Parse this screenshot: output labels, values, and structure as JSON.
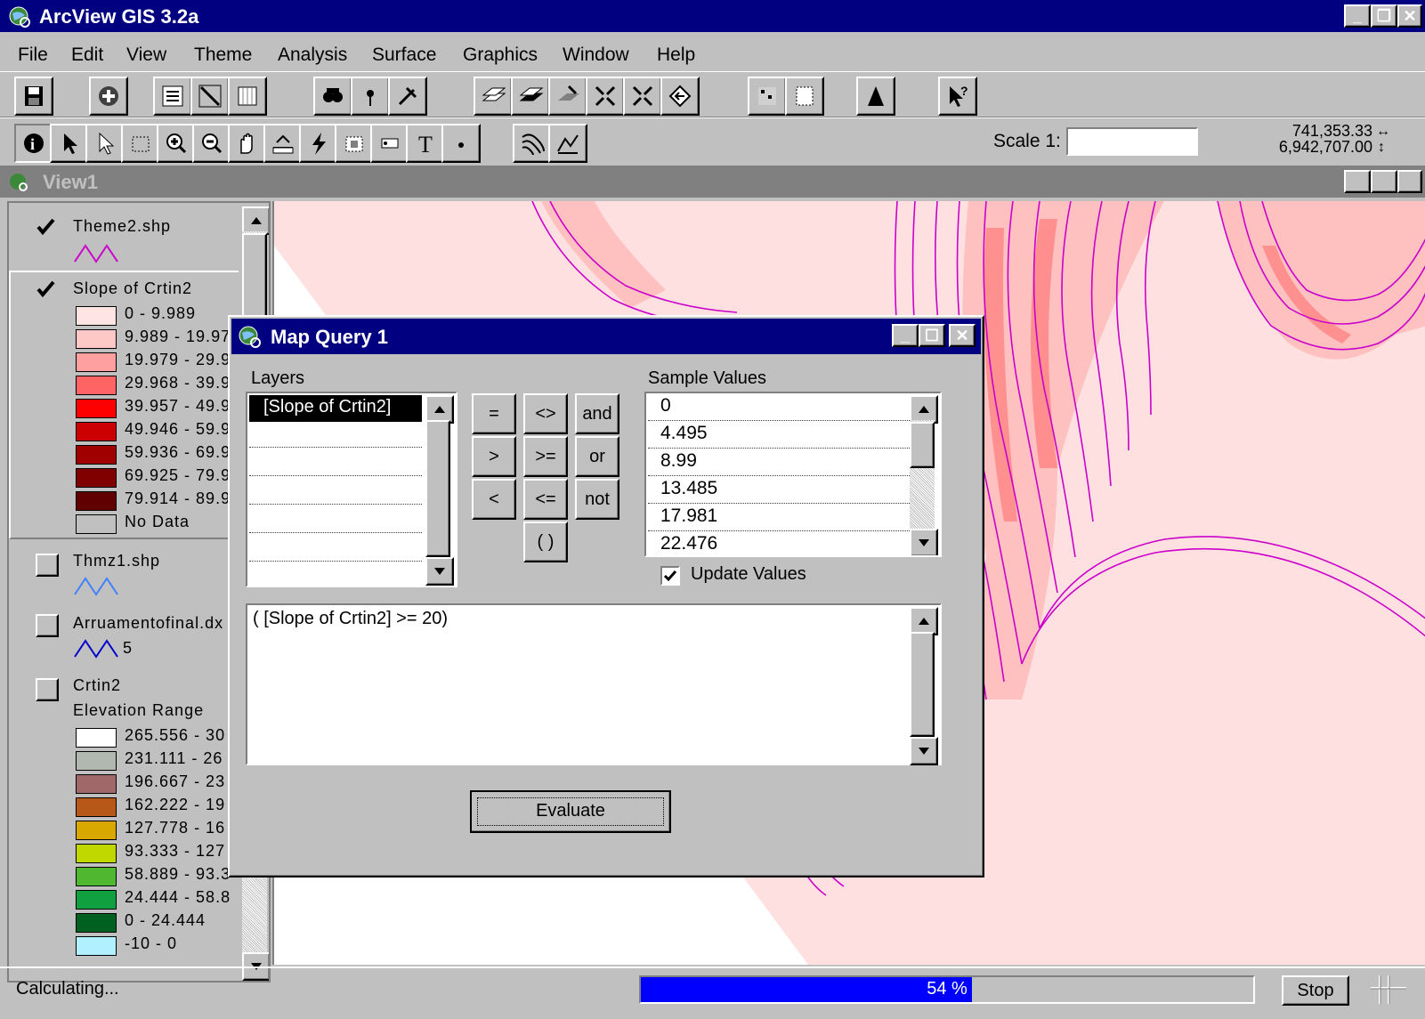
{
  "app": {
    "title": "ArcView GIS 3.2a"
  },
  "menu": [
    "File",
    "Edit",
    "View",
    "Theme",
    "Analysis",
    "Surface",
    "Graphics",
    "Window",
    "Help"
  ],
  "toolbar2": {
    "scale_label": "Scale 1:",
    "scale_value": "",
    "coord_x": "741,353.33",
    "coord_y": "6,942,707.00"
  },
  "view": {
    "title": "View1"
  },
  "toc": {
    "themes": [
      {
        "name": "Theme2.shp",
        "checked": true
      },
      {
        "name": "Slope of Crtin2",
        "checked": true,
        "classes": [
          {
            "label": "0 - 9.989",
            "color": "#ffe4e4"
          },
          {
            "label": "9.989 - 19.97",
            "color": "#ffc8c8"
          },
          {
            "label": "19.979 - 29.9",
            "color": "#ffa0a0"
          },
          {
            "label": "29.968 - 39.9",
            "color": "#ff6464"
          },
          {
            "label": "39.957 - 49.9",
            "color": "#ff0000"
          },
          {
            "label": "49.946 - 59.9",
            "color": "#cc0000"
          },
          {
            "label": "59.936 - 69.9",
            "color": "#a00000"
          },
          {
            "label": "69.925 - 79.9",
            "color": "#800000"
          },
          {
            "label": "79.914 - 89.9",
            "color": "#600000"
          },
          {
            "label": "No Data",
            "color": "#c0c0c0"
          }
        ]
      },
      {
        "name": "Thmz1.shp",
        "checked": false
      },
      {
        "name": "Arruamentofinal.dx",
        "checked": false,
        "legend_value": "5"
      },
      {
        "name": "Crtin2",
        "checked": false,
        "subtitle": "Elevation Range",
        "classes": [
          {
            "label": "265.556 - 30",
            "color": "#ffffff"
          },
          {
            "label": "231.111 - 26",
            "color": "#b0b8b0"
          },
          {
            "label": "196.667 - 23",
            "color": "#a06868"
          },
          {
            "label": "162.222 - 19",
            "color": "#b85818"
          },
          {
            "label": "127.778 - 16",
            "color": "#d8a800"
          },
          {
            "label": "93.333 - 127",
            "color": "#c0d800"
          },
          {
            "label": "58.889 - 93.3",
            "color": "#50b830"
          },
          {
            "label": "24.444 - 58.8",
            "color": "#10a040"
          },
          {
            "label": "0 - 24.444",
            "color": "#006020"
          },
          {
            "label": "-10 - 0",
            "color": "#b0f0ff"
          }
        ]
      }
    ]
  },
  "dialog": {
    "title": "Map Query 1",
    "layers_label": "Layers",
    "layers": [
      "[Slope of Crtin2]"
    ],
    "operators": [
      "=",
      "<>",
      "and",
      ">",
      ">=",
      "or",
      "<",
      "<=",
      "not",
      "( )"
    ],
    "sample_label": "Sample Values",
    "sample_values": [
      "0",
      "4.495",
      "8.99",
      "13.485",
      "17.981",
      "22.476"
    ],
    "update_values_label": "Update Values",
    "update_values_checked": true,
    "expression": "( [Slope of Crtin2] >= 20)",
    "evaluate_label": "Evaluate"
  },
  "status": {
    "text": "Calculating...",
    "progress_percent": 54,
    "progress_text": "54 %",
    "stop_label": "Stop"
  },
  "colors": {
    "titlebar": "#000080",
    "progress": "#0000ff",
    "map_bg": "#ffe0e0",
    "contour": "#cc00cc"
  }
}
